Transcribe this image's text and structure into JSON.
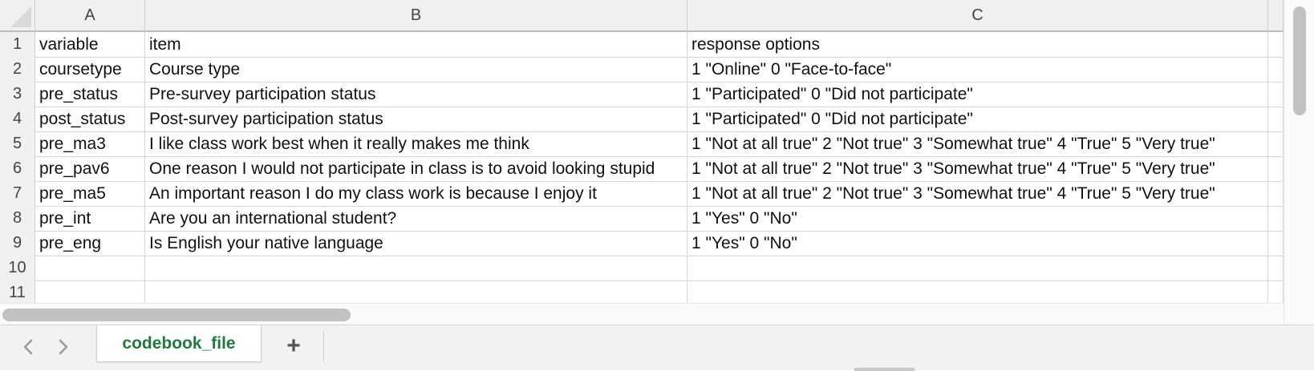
{
  "columns": [
    "A",
    "B",
    "C"
  ],
  "rows": [
    {
      "num": "1",
      "a": "variable",
      "b": "item",
      "c": "response options"
    },
    {
      "num": "2",
      "a": "coursetype",
      "b": "Course type",
      "c": "1 \"Online\" 0 \"Face-to-face\""
    },
    {
      "num": "3",
      "a": "pre_status",
      "b": "Pre-survey participation status",
      "c": "1 \"Participated\" 0 \"Did not participate\""
    },
    {
      "num": "4",
      "a": "post_status",
      "b": "Post-survey participation status",
      "c": "1 \"Participated\" 0 \"Did not participate\""
    },
    {
      "num": "5",
      "a": "pre_ma3",
      "b": "I like class work best when it really makes me think",
      "c": "1 \"Not at all true\" 2 \"Not true\" 3 \"Somewhat true\" 4 \"True\" 5 \"Very true\""
    },
    {
      "num": "6",
      "a": "pre_pav6",
      "b": "One reason I would not participate in class is to avoid looking stupid",
      "c": "1 \"Not at all true\" 2 \"Not true\" 3 \"Somewhat true\" 4 \"True\" 5 \"Very true\""
    },
    {
      "num": "7",
      "a": "pre_ma5",
      "b": "An important reason I do my class work is because I enjoy it",
      "c": "1 \"Not at all true\" 2 \"Not true\" 3 \"Somewhat true\" 4 \"True\" 5 \"Very true\""
    },
    {
      "num": "8",
      "a": "pre_int",
      "b": "Are you an international student?",
      "c": "1 \"Yes\"  0 \"No\""
    },
    {
      "num": "9",
      "a": "pre_eng",
      "b": "Is English your native language",
      "c": "1 \"Yes\"  0 \"No\""
    },
    {
      "num": "10",
      "a": "",
      "b": "",
      "c": ""
    },
    {
      "num": "11",
      "a": "",
      "b": "",
      "c": ""
    }
  ],
  "tabs": {
    "active_sheet": "codebook_file",
    "add_label": "+",
    "prev_icon": "chevron-left-icon",
    "next_icon": "chevron-right-icon"
  },
  "colors": {
    "active_tab_text": "#1f7a3c",
    "header_bg": "#f0f0f0",
    "gridline": "#d6d6d6"
  }
}
